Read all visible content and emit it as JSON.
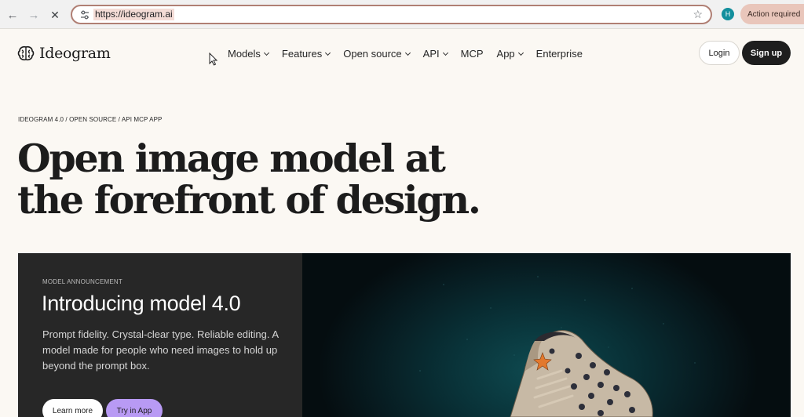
{
  "browser": {
    "url": "https://ideogram.ai",
    "profile_initial": "H",
    "action_required": "Action required"
  },
  "header": {
    "logo_text": "Ideogram",
    "nav": [
      {
        "label": "Models"
      },
      {
        "label": "Features"
      },
      {
        "label": "Open source"
      },
      {
        "label": "API"
      },
      {
        "label": "MCP"
      },
      {
        "label": "App"
      },
      {
        "label": "Enterprise"
      }
    ],
    "login_label": "Login",
    "signup_label": "Sign up"
  },
  "hero": {
    "breadcrumb": "IDEOGRAM 4.0 / OPEN SOURCE / API MCP APP",
    "title_line1": "Open image model at",
    "title_line2": "the forefront of design."
  },
  "card": {
    "eyebrow": "MODEL ANNOUNCEMENT",
    "title": "Introducing model 4.0",
    "description": "Prompt fidelity. Crystal-clear type. Reliable editing. A model made for people who need images to hold up beyond the prompt box.",
    "learn_more": "Learn more",
    "try_in_app": "Try in App"
  },
  "colors": {
    "page_bg": "#fbf8f3",
    "card_bg": "#272727",
    "accent_purple": "#b89af4",
    "url_border": "#b07f74",
    "avatar": "#138f9d"
  }
}
